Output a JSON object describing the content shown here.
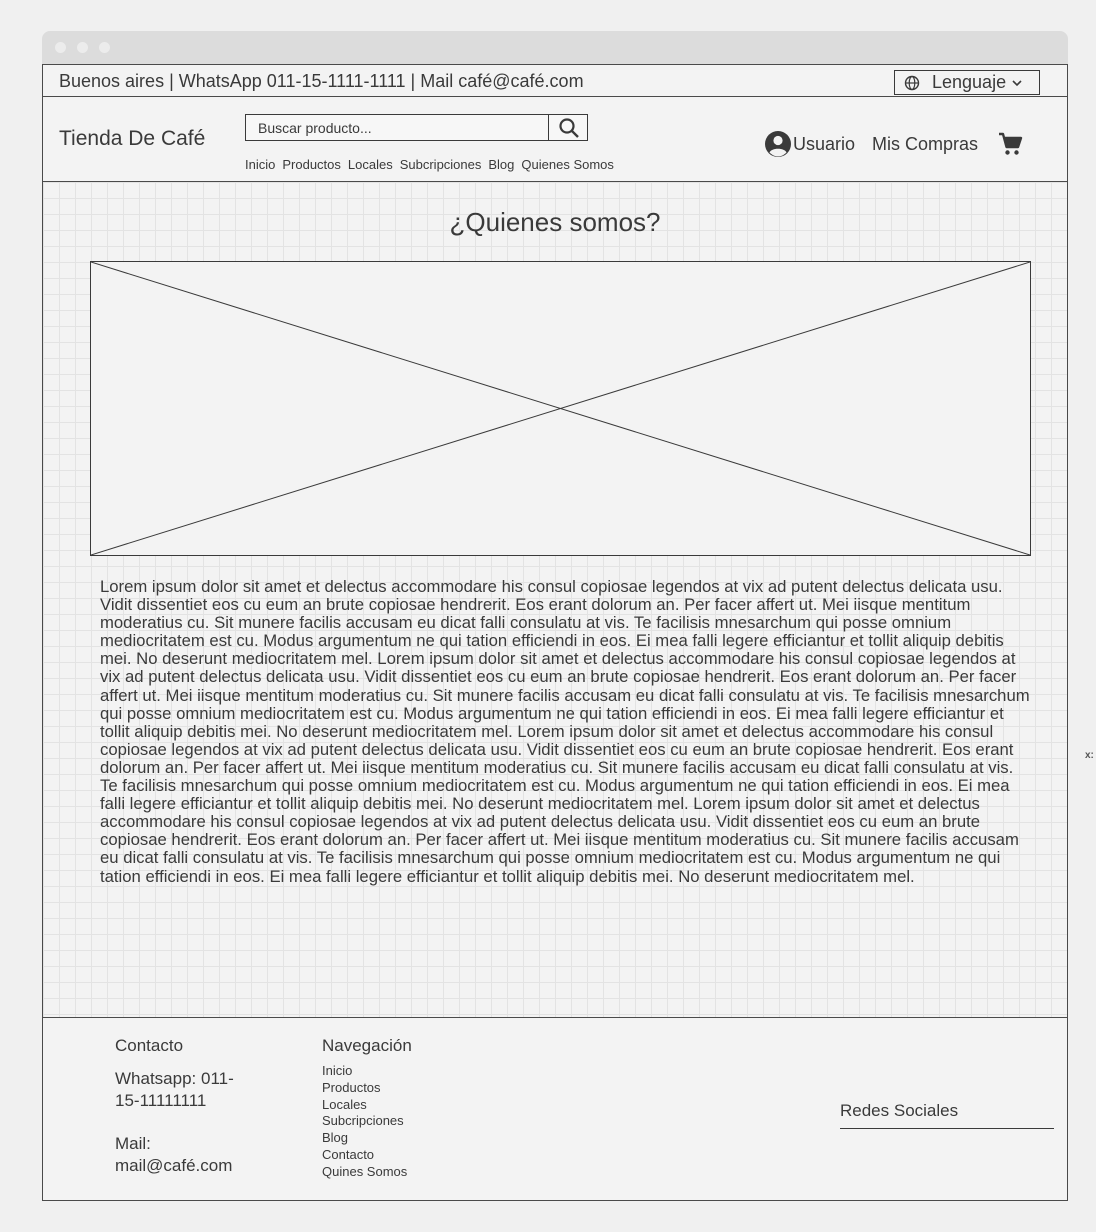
{
  "topbar": {
    "info": "Buenos aires | WhatsApp 011-15-1111-1111 | Mail café@café.com",
    "language_label": "Lenguaje"
  },
  "header": {
    "brand": "Tienda De Café",
    "search_placeholder": "Buscar producto...",
    "nav": [
      "Inicio",
      "Productos",
      "Locales",
      "Subcripciones",
      "Blog",
      "Quienes Somos"
    ],
    "user_label": "Usuario",
    "purchases_label": "Mis Compras"
  },
  "main": {
    "title": "¿Quienes somos?",
    "body": "Lorem ipsum dolor sit amet et delectus accommodare his consul copiosae legendos at vix ad putent delectus delicata usu. Vidit dissentiet eos cu eum an brute copiosae hendrerit. Eos erant dolorum an. Per facer affert ut. Mei iisque mentitum moderatius cu. Sit munere facilis accusam eu dicat falli consulatu at vis. Te facilisis mnesarchum qui posse omnium mediocritatem est cu. Modus argumentum ne qui tation efficiendi in eos. Ei mea falli legere efficiantur et tollit aliquip debitis mei. No deserunt mediocritatem mel. Lorem ipsum dolor sit amet et delectus accommodare his consul copiosae legendos at vix ad putent delectus delicata usu. Vidit dissentiet eos cu eum an brute copiosae hendrerit. Eos erant dolorum an. Per facer affert ut. Mei iisque mentitum moderatius cu. Sit munere facilis accusam eu dicat falli consulatu at vis. Te facilisis mnesarchum qui posse omnium mediocritatem est cu. Modus argumentum ne qui tation efficiendi in eos. Ei mea falli legere efficiantur et tollit aliquip debitis mei. No deserunt mediocritatem mel. Lorem ipsum dolor sit amet et delectus accommodare his consul copiosae legendos at vix ad putent delectus delicata usu. Vidit dissentiet eos cu eum an brute copiosae hendrerit. Eos erant dolorum an. Per facer affert ut. Mei iisque mentitum moderatius cu. Sit munere facilis accusam eu dicat falli consulatu at vis. Te facilisis mnesarchum qui posse omnium mediocritatem est cu. Modus argumentum ne qui tation efficiendi in eos. Ei mea falli legere efficiantur et tollit aliquip debitis mei. No deserunt mediocritatem mel. Lorem ipsum dolor sit amet et delectus accommodare his consul copiosae legendos at vix ad putent delectus delicata usu. Vidit dissentiet eos cu eum an brute copiosae hendrerit. Eos erant dolorum an. Per facer affert ut. Mei iisque mentitum moderatius cu. Sit munere facilis accusam eu dicat falli consulatu at vis. Te facilisis mnesarchum qui posse omnium mediocritatem est cu. Modus argumentum ne qui tation efficiendi in eos. Ei mea falli legere efficiantur et tollit aliquip debitis mei. No deserunt mediocritatem mel."
  },
  "footer": {
    "contact_title": "Contacto",
    "whatsapp": "Whatsapp: 011-15-11111111",
    "mail": "Mail: mail@café.com",
    "nav_title": "Navegación",
    "nav": [
      "Inicio",
      "Productos",
      "Locales",
      "Subcripciones",
      "Blog",
      "Contacto",
      "Quines Somos"
    ],
    "social_title": "Redes Sociales"
  },
  "side_label": "x:",
  "icons": {
    "language": "globe-icon",
    "dropdown": "chevron-down-icon",
    "search": "search-icon",
    "user": "user-icon",
    "cart": "cart-icon"
  }
}
